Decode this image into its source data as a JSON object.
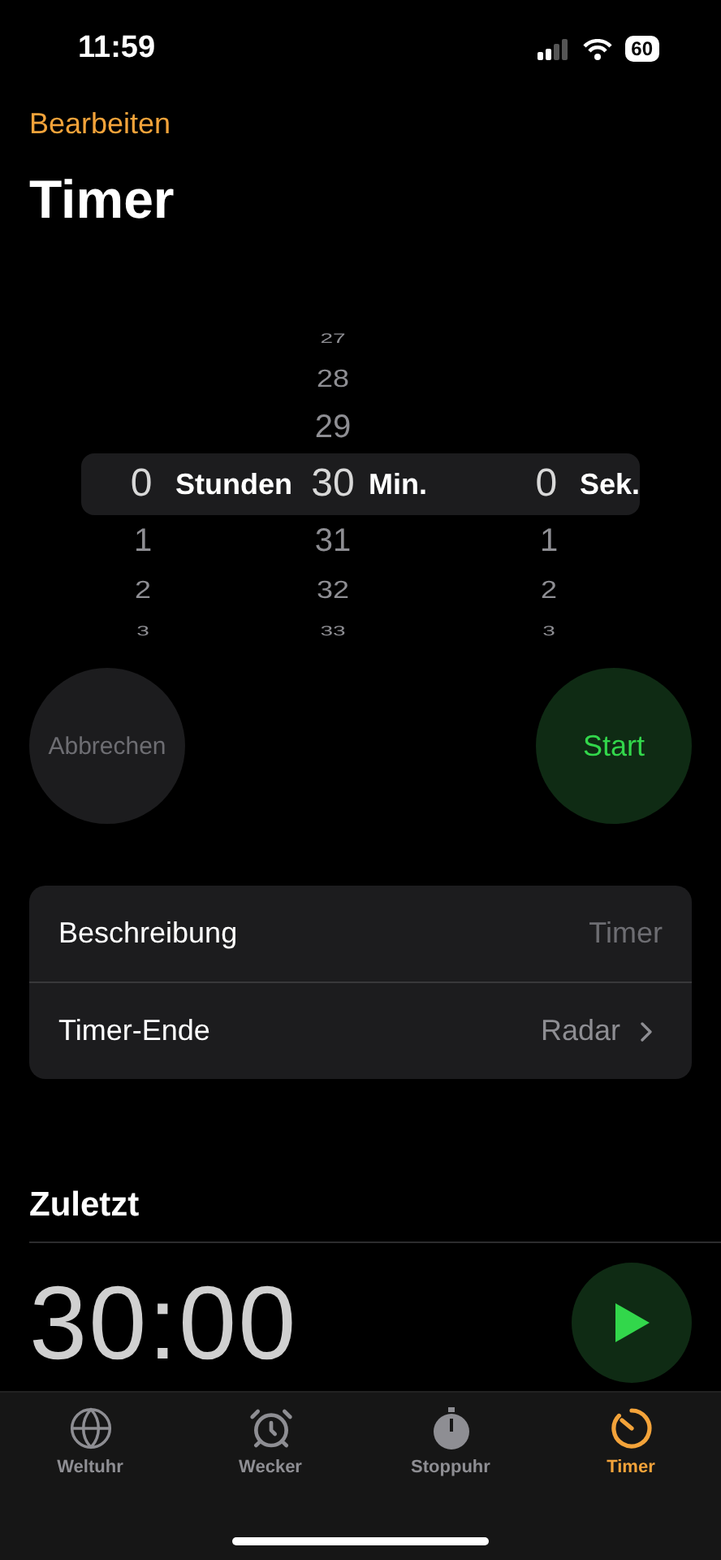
{
  "status_bar": {
    "time": "11:59",
    "battery": "60"
  },
  "nav": {
    "edit": "Bearbeiten",
    "title": "Timer"
  },
  "picker": {
    "columns": [
      {
        "unit": "Stunden",
        "value": "0",
        "below": [
          "1",
          "2",
          "3"
        ]
      },
      {
        "unit": "Min.",
        "above": [
          "27",
          "28",
          "29"
        ],
        "value": "30",
        "below": [
          "31",
          "32",
          "33"
        ]
      },
      {
        "unit": "Sek.",
        "value": "0",
        "below": [
          "1",
          "2",
          "3"
        ]
      }
    ]
  },
  "buttons": {
    "cancel": {
      "label": "Abbrechen",
      "disabled": true
    },
    "start": {
      "label": "Start"
    }
  },
  "settings": [
    {
      "kind": "field",
      "label": "Beschreibung",
      "placeholder": "Timer"
    },
    {
      "kind": "link",
      "label": "Timer-Ende",
      "value": "Radar"
    }
  ],
  "recent": {
    "title": "Zuletzt",
    "items": [
      {
        "time": "30:00"
      }
    ]
  },
  "tabs": [
    {
      "label": "Weltuhr",
      "kind": "globe",
      "selected": false
    },
    {
      "label": "Wecker",
      "kind": "alarm",
      "selected": false
    },
    {
      "label": "Stoppuhr",
      "kind": "stopwatch",
      "selected": false
    },
    {
      "label": "Timer",
      "kind": "timer",
      "selected": true
    }
  ]
}
